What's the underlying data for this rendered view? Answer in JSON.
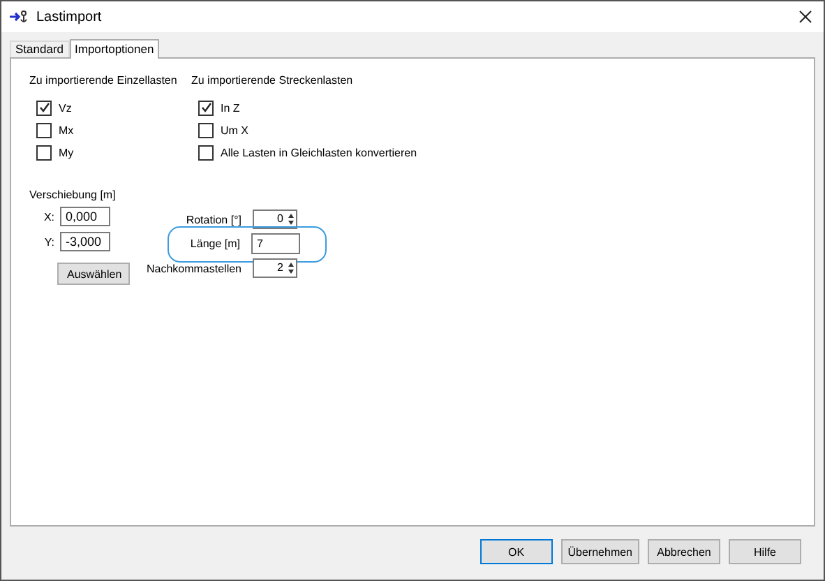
{
  "window": {
    "title": "Lastimport"
  },
  "tabs": [
    {
      "label": "Standard",
      "selected": false
    },
    {
      "label": "Importoptionen",
      "selected": true
    }
  ],
  "einzellasten": {
    "heading": "Zu importierende Einzellasten",
    "options": [
      {
        "label": "Vz",
        "checked": true
      },
      {
        "label": "Mx",
        "checked": false
      },
      {
        "label": "My",
        "checked": false
      }
    ]
  },
  "streckenlasten": {
    "heading": "Zu importierende Streckenlasten",
    "options": [
      {
        "label": "In Z",
        "checked": true
      },
      {
        "label": "Um X",
        "checked": false
      },
      {
        "label": "Alle Lasten in Gleichlasten konvertieren",
        "checked": false
      }
    ]
  },
  "verschiebung": {
    "heading": "Verschiebung [m]",
    "fields": [
      {
        "label": "X:",
        "value": "0,000"
      },
      {
        "label": "Y:",
        "value": "-3,000"
      }
    ],
    "button": "Auswählen"
  },
  "parameters": [
    {
      "kind": "spinner",
      "label": "Rotation [°]",
      "value": "0",
      "highlighted": false
    },
    {
      "kind": "text",
      "label": "Länge [m]",
      "value": "7",
      "highlighted": true
    },
    {
      "kind": "spinner",
      "label": "Nachkommastellen",
      "value": "2",
      "highlighted": false
    }
  ],
  "buttons": [
    {
      "label": "OK",
      "default": true
    },
    {
      "label": "Übernehmen",
      "default": false
    },
    {
      "label": "Abbrechen",
      "default": false
    },
    {
      "label": "Hilfe",
      "default": false
    }
  ]
}
